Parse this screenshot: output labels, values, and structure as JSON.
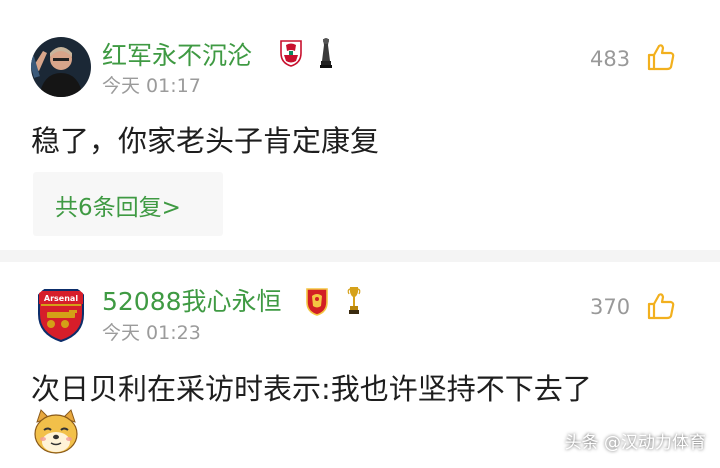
{
  "comments": [
    {
      "username": "红军永不沉沦",
      "time": "今天 01:17",
      "likes": "483",
      "content": "稳了，你家老头子肯定康复",
      "replies": "共6条回复>"
    },
    {
      "username": "52088我心永恒",
      "time": "今天 01:23",
      "likes": "370",
      "content": "次日贝利在采访时表示:我也许坚持不下去了",
      "badge_text": "Arsenal"
    }
  ],
  "watermark": "头条 @汉动力体育",
  "colors": {
    "username": "#3f9a43",
    "meta": "#9b9b9b",
    "text": "#1e1e1e",
    "thumb": "#f2b01e"
  },
  "icons": {
    "thumbs_up": "thumbs-up-icon",
    "liverpool_badge": "liverpool-badge-icon",
    "guangzhou_badge": "guangzhou-badge-icon",
    "trophy": "trophy-icon",
    "emoji": "doge-emoji-icon"
  }
}
